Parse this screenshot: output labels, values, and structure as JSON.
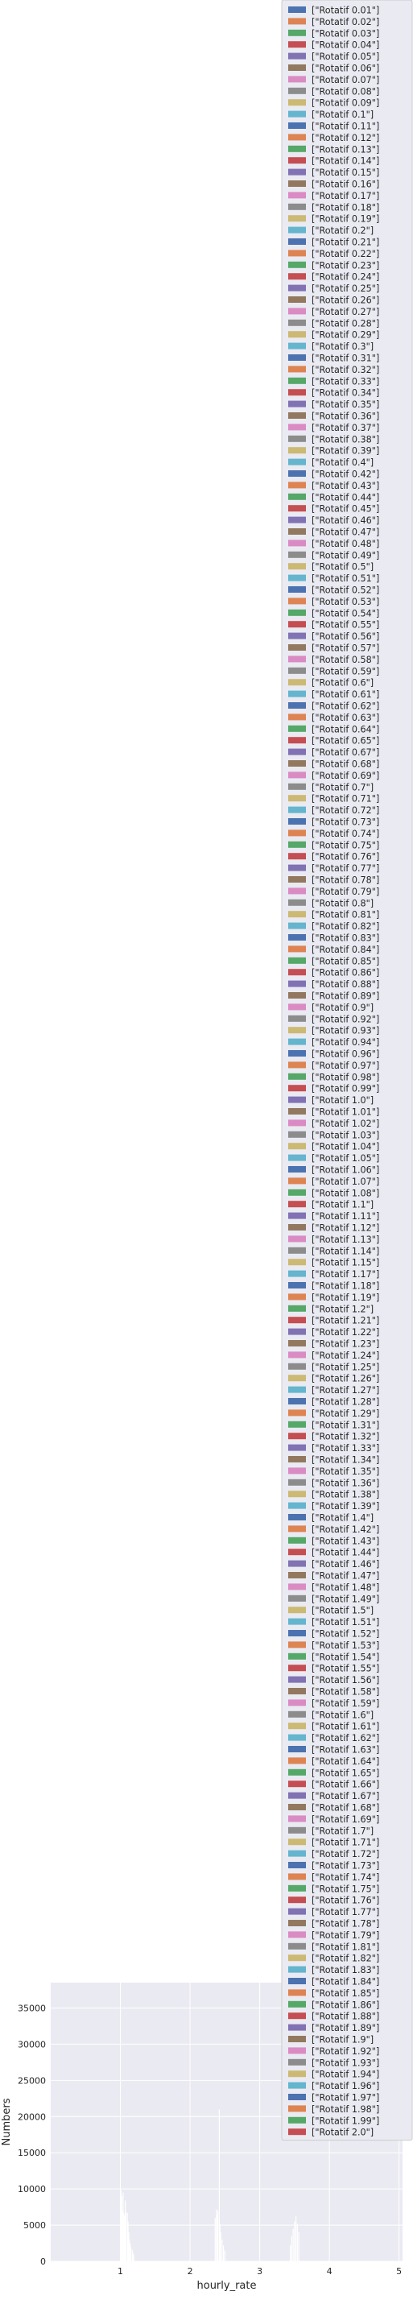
{
  "chart_data": {
    "type": "bar",
    "xlabel": "hourly_rate",
    "ylabel": "Numbers",
    "xlim": [
      0.0,
      5.05
    ],
    "ylim": [
      0,
      38500
    ],
    "xticks": [
      1,
      2,
      3,
      4,
      5
    ],
    "yticks": [
      0,
      5000,
      10000,
      15000,
      20000,
      25000,
      30000,
      35000
    ],
    "grid": true,
    "legend_position": "upper-right",
    "bar_width": 0.008,
    "bar_color": "#ffffff",
    "plot_background": "#eaeaf2",
    "legend_colors": [
      "#4c72b0",
      "#dd8452",
      "#55a868",
      "#c44e52",
      "#8172b3",
      "#937860",
      "#da8bc3",
      "#8c8c8c",
      "#ccb974",
      "#64b5cd"
    ],
    "series_prefix": "[\"Rotatif ",
    "series_suffix": "\"]",
    "series": [
      {
        "name": "[\"Rotatif 0.01\"]",
        "x": 0.01,
        "value": 0
      },
      {
        "name": "[\"Rotatif 0.02\"]",
        "x": 0.02,
        "value": 0
      },
      {
        "name": "[\"Rotatif 0.03\"]",
        "x": 0.03,
        "value": 0
      },
      {
        "name": "[\"Rotatif 0.04\"]",
        "x": 0.04,
        "value": 0
      },
      {
        "name": "[\"Rotatif 0.05\"]",
        "x": 0.05,
        "value": 0
      },
      {
        "name": "[\"Rotatif 0.06\"]",
        "x": 0.06,
        "value": 0
      },
      {
        "name": "[\"Rotatif 0.07\"]",
        "x": 0.07,
        "value": 0
      },
      {
        "name": "[\"Rotatif 0.08\"]",
        "x": 0.08,
        "value": 0
      },
      {
        "name": "[\"Rotatif 0.09\"]",
        "x": 0.09,
        "value": 0
      },
      {
        "name": "[\"Rotatif 0.1\"]",
        "x": 0.1,
        "value": 0
      },
      {
        "name": "[\"Rotatif 0.11\"]",
        "x": 0.11,
        "value": 0
      },
      {
        "name": "[\"Rotatif 0.12\"]",
        "x": 0.12,
        "value": 0
      },
      {
        "name": "[\"Rotatif 0.13\"]",
        "x": 0.13,
        "value": 0
      },
      {
        "name": "[\"Rotatif 0.14\"]",
        "x": 0.14,
        "value": 0
      },
      {
        "name": "[\"Rotatif 0.15\"]",
        "x": 0.15,
        "value": 0
      },
      {
        "name": "[\"Rotatif 0.16\"]",
        "x": 0.16,
        "value": 0
      },
      {
        "name": "[\"Rotatif 0.17\"]",
        "x": 0.17,
        "value": 0
      },
      {
        "name": "[\"Rotatif 0.18\"]",
        "x": 0.18,
        "value": 0
      },
      {
        "name": "[\"Rotatif 0.19\"]",
        "x": 0.19,
        "value": 0
      },
      {
        "name": "[\"Rotatif 0.2\"]",
        "x": 0.2,
        "value": 0
      },
      {
        "name": "[\"Rotatif 0.21\"]",
        "x": 0.21,
        "value": 0
      },
      {
        "name": "[\"Rotatif 0.22\"]",
        "x": 0.22,
        "value": 0
      },
      {
        "name": "[\"Rotatif 0.23\"]",
        "x": 0.23,
        "value": 0
      },
      {
        "name": "[\"Rotatif 0.24\"]",
        "x": 0.24,
        "value": 0
      },
      {
        "name": "[\"Rotatif 0.25\"]",
        "x": 0.25,
        "value": 0
      },
      {
        "name": "[\"Rotatif 0.26\"]",
        "x": 0.26,
        "value": 0
      },
      {
        "name": "[\"Rotatif 0.27\"]",
        "x": 0.27,
        "value": 0
      },
      {
        "name": "[\"Rotatif 0.28\"]",
        "x": 0.28,
        "value": 0
      },
      {
        "name": "[\"Rotatif 0.29\"]",
        "x": 0.29,
        "value": 0
      },
      {
        "name": "[\"Rotatif 0.3\"]",
        "x": 0.3,
        "value": 0
      },
      {
        "name": "[\"Rotatif 0.31\"]",
        "x": 0.31,
        "value": 0
      },
      {
        "name": "[\"Rotatif 0.32\"]",
        "x": 0.32,
        "value": 0
      },
      {
        "name": "[\"Rotatif 0.33\"]",
        "x": 0.33,
        "value": 0
      },
      {
        "name": "[\"Rotatif 0.34\"]",
        "x": 0.34,
        "value": 0
      },
      {
        "name": "[\"Rotatif 0.35\"]",
        "x": 0.35,
        "value": 0
      },
      {
        "name": "[\"Rotatif 0.36\"]",
        "x": 0.36,
        "value": 0
      },
      {
        "name": "[\"Rotatif 0.37\"]",
        "x": 0.37,
        "value": 0
      },
      {
        "name": "[\"Rotatif 0.38\"]",
        "x": 0.38,
        "value": 0
      },
      {
        "name": "[\"Rotatif 0.39\"]",
        "x": 0.39,
        "value": 0
      },
      {
        "name": "[\"Rotatif 0.4\"]",
        "x": 0.4,
        "value": 0
      },
      {
        "name": "[\"Rotatif 0.42\"]",
        "x": 0.42,
        "value": 0
      },
      {
        "name": "[\"Rotatif 0.43\"]",
        "x": 0.43,
        "value": 0
      },
      {
        "name": "[\"Rotatif 0.44\"]",
        "x": 0.44,
        "value": 0
      },
      {
        "name": "[\"Rotatif 0.45\"]",
        "x": 0.45,
        "value": 0
      },
      {
        "name": "[\"Rotatif 0.46\"]",
        "x": 0.46,
        "value": 0
      },
      {
        "name": "[\"Rotatif 0.47\"]",
        "x": 0.47,
        "value": 0
      },
      {
        "name": "[\"Rotatif 0.48\"]",
        "x": 0.48,
        "value": 0
      },
      {
        "name": "[\"Rotatif 0.49\"]",
        "x": 0.49,
        "value": 0
      },
      {
        "name": "[\"Rotatif 0.5\"]",
        "x": 0.5,
        "value": 0
      },
      {
        "name": "[\"Rotatif 0.51\"]",
        "x": 0.51,
        "value": 0
      },
      {
        "name": "[\"Rotatif 0.52\"]",
        "x": 0.52,
        "value": 0
      },
      {
        "name": "[\"Rotatif 0.53\"]",
        "x": 0.53,
        "value": 0
      },
      {
        "name": "[\"Rotatif 0.54\"]",
        "x": 0.54,
        "value": 0
      },
      {
        "name": "[\"Rotatif 0.55\"]",
        "x": 0.55,
        "value": 0
      },
      {
        "name": "[\"Rotatif 0.56\"]",
        "x": 0.56,
        "value": 0
      },
      {
        "name": "[\"Rotatif 0.57\"]",
        "x": 0.57,
        "value": 0
      },
      {
        "name": "[\"Rotatif 0.58\"]",
        "x": 0.58,
        "value": 0
      },
      {
        "name": "[\"Rotatif 0.59\"]",
        "x": 0.59,
        "value": 0
      },
      {
        "name": "[\"Rotatif 0.6\"]",
        "x": 0.6,
        "value": 0
      },
      {
        "name": "[\"Rotatif 0.61\"]",
        "x": 0.61,
        "value": 0
      },
      {
        "name": "[\"Rotatif 0.62\"]",
        "x": 0.62,
        "value": 0
      },
      {
        "name": "[\"Rotatif 0.63\"]",
        "x": 0.63,
        "value": 0
      },
      {
        "name": "[\"Rotatif 0.64\"]",
        "x": 0.64,
        "value": 0
      },
      {
        "name": "[\"Rotatif 0.65\"]",
        "x": 0.65,
        "value": 0
      },
      {
        "name": "[\"Rotatif 0.67\"]",
        "x": 0.67,
        "value": 0
      },
      {
        "name": "[\"Rotatif 0.68\"]",
        "x": 0.68,
        "value": 0
      },
      {
        "name": "[\"Rotatif 0.69\"]",
        "x": 0.69,
        "value": 0
      },
      {
        "name": "[\"Rotatif 0.7\"]",
        "x": 0.7,
        "value": 0
      },
      {
        "name": "[\"Rotatif 0.71\"]",
        "x": 0.71,
        "value": 0
      },
      {
        "name": "[\"Rotatif 0.72\"]",
        "x": 0.72,
        "value": 0
      },
      {
        "name": "[\"Rotatif 0.73\"]",
        "x": 0.73,
        "value": 0
      },
      {
        "name": "[\"Rotatif 0.74\"]",
        "x": 0.74,
        "value": 0
      },
      {
        "name": "[\"Rotatif 0.75\"]",
        "x": 0.75,
        "value": 0
      },
      {
        "name": "[\"Rotatif 0.76\"]",
        "x": 0.76,
        "value": 0
      },
      {
        "name": "[\"Rotatif 0.77\"]",
        "x": 0.77,
        "value": 0
      },
      {
        "name": "[\"Rotatif 0.78\"]",
        "x": 0.78,
        "value": 0
      },
      {
        "name": "[\"Rotatif 0.79\"]",
        "x": 0.79,
        "value": 0
      },
      {
        "name": "[\"Rotatif 0.8\"]",
        "x": 0.8,
        "value": 0
      },
      {
        "name": "[\"Rotatif 0.81\"]",
        "x": 0.81,
        "value": 0
      },
      {
        "name": "[\"Rotatif 0.82\"]",
        "x": 0.82,
        "value": 0
      },
      {
        "name": "[\"Rotatif 0.83\"]",
        "x": 0.83,
        "value": 0
      },
      {
        "name": "[\"Rotatif 0.84\"]",
        "x": 0.84,
        "value": 0
      },
      {
        "name": "[\"Rotatif 0.85\"]",
        "x": 0.85,
        "value": 0
      },
      {
        "name": "[\"Rotatif 0.86\"]",
        "x": 0.86,
        "value": 0
      },
      {
        "name": "[\"Rotatif 0.88\"]",
        "x": 0.88,
        "value": 0
      },
      {
        "name": "[\"Rotatif 0.89\"]",
        "x": 0.89,
        "value": 0
      },
      {
        "name": "[\"Rotatif 0.9\"]",
        "x": 0.9,
        "value": 0
      },
      {
        "name": "[\"Rotatif 0.92\"]",
        "x": 0.92,
        "value": 0
      },
      {
        "name": "[\"Rotatif 0.93\"]",
        "x": 0.93,
        "value": 0
      },
      {
        "name": "[\"Rotatif 0.94\"]",
        "x": 0.94,
        "value": 0
      },
      {
        "name": "[\"Rotatif 0.96\"]",
        "x": 0.96,
        "value": 0
      },
      {
        "name": "[\"Rotatif 0.97\"]",
        "x": 0.97,
        "value": 0
      },
      {
        "name": "[\"Rotatif 0.98\"]",
        "x": 0.98,
        "value": 0
      },
      {
        "name": "[\"Rotatif 0.99\"]",
        "x": 0.99,
        "value": 0
      },
      {
        "name": "[\"Rotatif 1.0\"]",
        "x": 1.0,
        "value": 10000
      },
      {
        "name": "[\"Rotatif 1.01\"]",
        "x": 1.01,
        "value": 9800
      },
      {
        "name": "[\"Rotatif 1.02\"]",
        "x": 1.02,
        "value": 9000
      },
      {
        "name": "[\"Rotatif 1.03\"]",
        "x": 1.03,
        "value": 7000
      },
      {
        "name": "[\"Rotatif 1.04\"]",
        "x": 1.04,
        "value": 9500
      },
      {
        "name": "[\"Rotatif 1.05\"]",
        "x": 1.05,
        "value": 6600
      },
      {
        "name": "[\"Rotatif 1.06\"]",
        "x": 1.06,
        "value": 6300
      },
      {
        "name": "[\"Rotatif 1.07\"]",
        "x": 1.07,
        "value": 8400
      },
      {
        "name": "[\"Rotatif 1.08\"]",
        "x": 1.08,
        "value": 6800
      },
      {
        "name": "[\"Rotatif 1.1\"]",
        "x": 1.1,
        "value": 6700
      },
      {
        "name": "[\"Rotatif 1.11\"]",
        "x": 1.11,
        "value": 5500
      },
      {
        "name": "[\"Rotatif 1.12\"]",
        "x": 1.12,
        "value": 4000
      },
      {
        "name": "[\"Rotatif 1.13\"]",
        "x": 1.13,
        "value": 3000
      },
      {
        "name": "[\"Rotatif 1.14\"]",
        "x": 1.14,
        "value": 2500
      },
      {
        "name": "[\"Rotatif 1.15\"]",
        "x": 1.15,
        "value": 2000
      },
      {
        "name": "[\"Rotatif 1.17\"]",
        "x": 1.17,
        "value": 1600
      },
      {
        "name": "[\"Rotatif 1.18\"]",
        "x": 1.18,
        "value": 1200
      },
      {
        "name": "[\"Rotatif 1.19\"]",
        "x": 1.19,
        "value": 900
      },
      {
        "name": "[\"Rotatif 1.2\"]",
        "x": 1.2,
        "value": 0
      },
      {
        "name": "[\"Rotatif 1.21\"]",
        "x": 1.21,
        "value": 0
      },
      {
        "name": "[\"Rotatif 1.22\"]",
        "x": 1.22,
        "value": 0
      },
      {
        "name": "[\"Rotatif 1.23\"]",
        "x": 1.23,
        "value": 0
      },
      {
        "name": "[\"Rotatif 1.24\"]",
        "x": 1.24,
        "value": 0
      },
      {
        "name": "[\"Rotatif 1.25\"]",
        "x": 1.25,
        "value": 0
      },
      {
        "name": "[\"Rotatif 1.26\"]",
        "x": 1.26,
        "value": 0
      },
      {
        "name": "[\"Rotatif 1.27\"]",
        "x": 1.27,
        "value": 0
      },
      {
        "name": "[\"Rotatif 1.28\"]",
        "x": 1.28,
        "value": 0
      },
      {
        "name": "[\"Rotatif 1.29\"]",
        "x": 1.29,
        "value": 0
      },
      {
        "name": "[\"Rotatif 1.31\"]",
        "x": 1.31,
        "value": 0
      },
      {
        "name": "[\"Rotatif 1.32\"]",
        "x": 1.32,
        "value": 0
      },
      {
        "name": "[\"Rotatif 1.33\"]",
        "x": 1.33,
        "value": 0
      },
      {
        "name": "[\"Rotatif 1.34\"]",
        "x": 1.34,
        "value": 0
      },
      {
        "name": "[\"Rotatif 1.35\"]",
        "x": 1.35,
        "value": 0
      },
      {
        "name": "[\"Rotatif 1.36\"]",
        "x": 1.36,
        "value": 0
      },
      {
        "name": "[\"Rotatif 1.38\"]",
        "x": 1.38,
        "value": 0
      },
      {
        "name": "[\"Rotatif 1.39\"]",
        "x": 1.39,
        "value": 0
      },
      {
        "name": "[\"Rotatif 1.4\"]",
        "x": 1.4,
        "value": 0
      },
      {
        "name": "[\"Rotatif 1.42\"]",
        "x": 1.42,
        "value": 0
      },
      {
        "name": "[\"Rotatif 1.43\"]",
        "x": 1.43,
        "value": 0
      },
      {
        "name": "[\"Rotatif 1.44\"]",
        "x": 1.44,
        "value": 0
      },
      {
        "name": "[\"Rotatif 1.46\"]",
        "x": 1.46,
        "value": 0
      },
      {
        "name": "[\"Rotatif 1.47\"]",
        "x": 1.47,
        "value": 0
      },
      {
        "name": "[\"Rotatif 1.48\"]",
        "x": 1.48,
        "value": 0
      },
      {
        "name": "[\"Rotatif 1.49\"]",
        "x": 1.49,
        "value": 0
      },
      {
        "name": "[\"Rotatif 1.5\"]",
        "x": 1.5,
        "value": 0
      },
      {
        "name": "[\"Rotatif 1.51\"]",
        "x": 1.51,
        "value": 0
      },
      {
        "name": "[\"Rotatif 1.52\"]",
        "x": 1.52,
        "value": 0
      },
      {
        "name": "[\"Rotatif 1.53\"]",
        "x": 1.53,
        "value": 0
      },
      {
        "name": "[\"Rotatif 1.54\"]",
        "x": 1.54,
        "value": 0
      },
      {
        "name": "[\"Rotatif 1.55\"]",
        "x": 1.55,
        "value": 0
      },
      {
        "name": "[\"Rotatif 1.56\"]",
        "x": 1.56,
        "value": 0
      },
      {
        "name": "[\"Rotatif 1.58\"]",
        "x": 1.58,
        "value": 0
      },
      {
        "name": "[\"Rotatif 1.59\"]",
        "x": 1.59,
        "value": 0
      },
      {
        "name": "[\"Rotatif 1.6\"]",
        "x": 1.6,
        "value": 0
      },
      {
        "name": "[\"Rotatif 1.61\"]",
        "x": 1.61,
        "value": 0
      },
      {
        "name": "[\"Rotatif 1.62\"]",
        "x": 1.62,
        "value": 0
      },
      {
        "name": "[\"Rotatif 1.63\"]",
        "x": 1.63,
        "value": 0
      },
      {
        "name": "[\"Rotatif 1.64\"]",
        "x": 1.64,
        "value": 0
      },
      {
        "name": "[\"Rotatif 1.65\"]",
        "x": 1.65,
        "value": 0
      },
      {
        "name": "[\"Rotatif 1.66\"]",
        "x": 1.66,
        "value": 0
      },
      {
        "name": "[\"Rotatif 1.67\"]",
        "x": 1.67,
        "value": 0
      },
      {
        "name": "[\"Rotatif 1.68\"]",
        "x": 1.68,
        "value": 0
      },
      {
        "name": "[\"Rotatif 1.69\"]",
        "x": 1.69,
        "value": 0
      },
      {
        "name": "[\"Rotatif 1.7\"]",
        "x": 1.7,
        "value": 0
      },
      {
        "name": "[\"Rotatif 1.71\"]",
        "x": 1.71,
        "value": 0
      },
      {
        "name": "[\"Rotatif 1.72\"]",
        "x": 1.72,
        "value": 0
      },
      {
        "name": "[\"Rotatif 1.73\"]",
        "x": 1.73,
        "value": 0
      },
      {
        "name": "[\"Rotatif 1.74\"]",
        "x": 1.74,
        "value": 0
      },
      {
        "name": "[\"Rotatif 1.75\"]",
        "x": 1.75,
        "value": 0
      },
      {
        "name": "[\"Rotatif 1.76\"]",
        "x": 1.76,
        "value": 0
      },
      {
        "name": "[\"Rotatif 1.77\"]",
        "x": 1.77,
        "value": 0
      },
      {
        "name": "[\"Rotatif 1.78\"]",
        "x": 1.78,
        "value": 0
      },
      {
        "name": "[\"Rotatif 1.79\"]",
        "x": 1.79,
        "value": 0
      },
      {
        "name": "[\"Rotatif 1.81\"]",
        "x": 1.81,
        "value": 0
      },
      {
        "name": "[\"Rotatif 1.82\"]",
        "x": 1.82,
        "value": 0
      },
      {
        "name": "[\"Rotatif 1.83\"]",
        "x": 1.83,
        "value": 0
      },
      {
        "name": "[\"Rotatif 1.84\"]",
        "x": 1.84,
        "value": 0
      },
      {
        "name": "[\"Rotatif 1.85\"]",
        "x": 1.85,
        "value": 0
      },
      {
        "name": "[\"Rotatif 1.86\"]",
        "x": 1.86,
        "value": 0
      },
      {
        "name": "[\"Rotatif 1.88\"]",
        "x": 1.88,
        "value": 0
      },
      {
        "name": "[\"Rotatif 1.89\"]",
        "x": 1.89,
        "value": 0
      },
      {
        "name": "[\"Rotatif 1.9\"]",
        "x": 1.9,
        "value": 0
      },
      {
        "name": "[\"Rotatif 1.92\"]",
        "x": 1.92,
        "value": 0
      },
      {
        "name": "[\"Rotatif 1.93\"]",
        "x": 1.93,
        "value": 0
      },
      {
        "name": "[\"Rotatif 1.94\"]",
        "x": 1.94,
        "value": 0
      },
      {
        "name": "[\"Rotatif 1.96\"]",
        "x": 1.96,
        "value": 0
      },
      {
        "name": "[\"Rotatif 1.97\"]",
        "x": 1.97,
        "value": 0
      },
      {
        "name": "[\"Rotatif 1.98\"]",
        "x": 1.98,
        "value": 0
      },
      {
        "name": "[\"Rotatif 1.99\"]",
        "x": 1.99,
        "value": 0
      },
      {
        "name": "[\"Rotatif 2.0\"]",
        "x": 2.0,
        "value": 0
      }
    ],
    "extra_bars": [
      {
        "x": 2.36,
        "value": 6000
      },
      {
        "x": 2.38,
        "value": 7200
      },
      {
        "x": 2.39,
        "value": 6500
      },
      {
        "x": 2.4,
        "value": 7000
      },
      {
        "x": 2.42,
        "value": 21000
      },
      {
        "x": 2.43,
        "value": 5200
      },
      {
        "x": 2.44,
        "value": 4000
      },
      {
        "x": 2.46,
        "value": 3000
      },
      {
        "x": 2.48,
        "value": 2200
      },
      {
        "x": 2.5,
        "value": 1500
      },
      {
        "x": 3.44,
        "value": 2200
      },
      {
        "x": 3.46,
        "value": 3500
      },
      {
        "x": 3.48,
        "value": 4500
      },
      {
        "x": 3.5,
        "value": 5500
      },
      {
        "x": 3.52,
        "value": 6200
      },
      {
        "x": 3.54,
        "value": 5200
      },
      {
        "x": 3.56,
        "value": 4000
      }
    ]
  }
}
